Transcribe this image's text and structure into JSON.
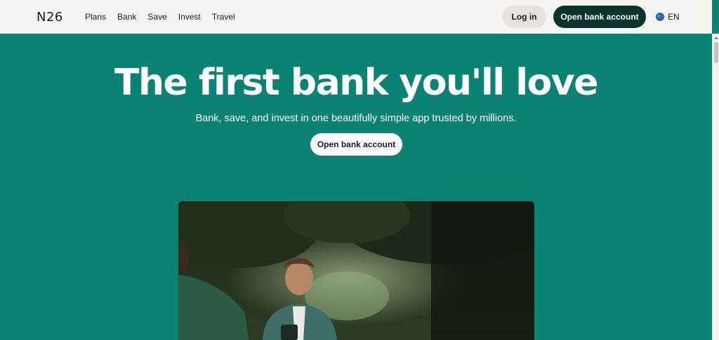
{
  "header": {
    "logo_text": "N26",
    "nav": [
      "Plans",
      "Bank",
      "Save",
      "Invest",
      "Travel"
    ],
    "login_label": "Log in",
    "open_account_label": "Open bank account",
    "language": "EN"
  },
  "hero": {
    "title": "The first bank you'll love",
    "subtitle": "Bank, save, and invest in one beautifully simple app trusted by millions.",
    "cta_label": "Open bank account"
  },
  "colors": {
    "accent": "#0a8274",
    "header_bg": "#f6f4f1",
    "primary_button": "#08342e",
    "login_button": "#e8e2dc"
  },
  "icons": {
    "language": "globe-icon"
  }
}
